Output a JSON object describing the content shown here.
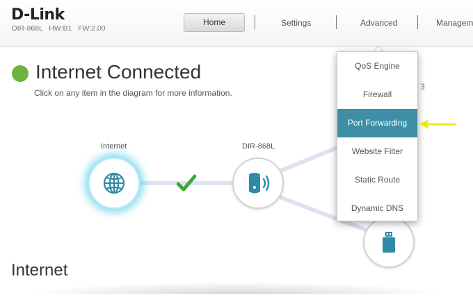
{
  "header": {
    "logo": "D-Link",
    "device_info": "DIR-868L   HW:B1   FW:2.00",
    "nav": {
      "home": "Home",
      "settings": "Settings",
      "advanced": "Advanced",
      "management": "Manageme"
    }
  },
  "status": {
    "title": "Internet Connected",
    "hint": "Click on any item in the diagram for more information.",
    "right_fragment": ": 3",
    "color": "#6cb33f"
  },
  "diagram": {
    "internet_label": "Internet",
    "router_label": "DIR-868L",
    "connection_icon": "check-icon",
    "check_color": "#3aa832",
    "glow_color": "#58cde8"
  },
  "advanced_menu": {
    "items": [
      {
        "label": "QoS Engine"
      },
      {
        "label": "Firewall"
      },
      {
        "label": "Port Forwarding",
        "active": true
      },
      {
        "label": "Website Filter"
      },
      {
        "label": "Static Route"
      },
      {
        "label": "Dynamic DNS"
      }
    ],
    "active_color": "#3e8ea6",
    "pointer_color": "#f0e61e"
  },
  "section": {
    "title": "Internet"
  }
}
